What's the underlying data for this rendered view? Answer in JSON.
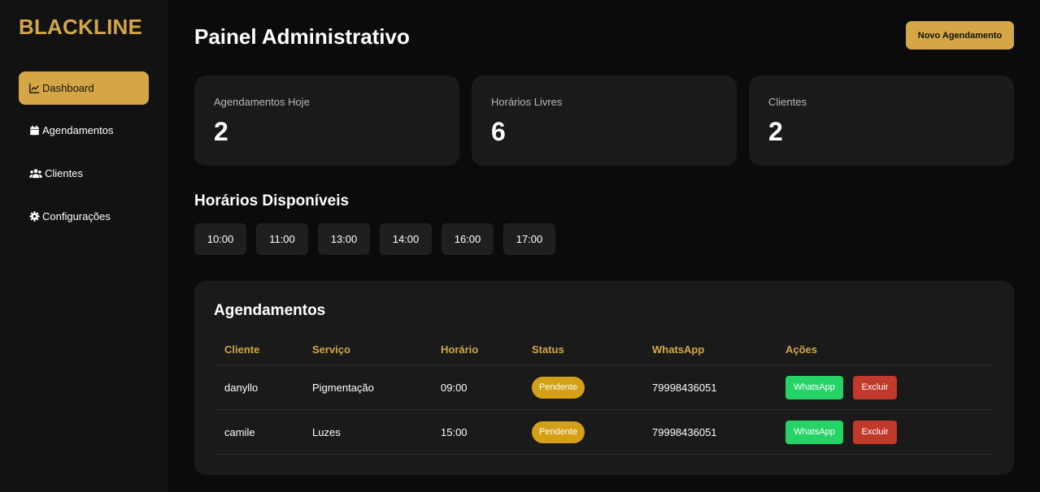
{
  "brand": "BLACKLINE",
  "nav": [
    {
      "label": "Dashboard",
      "icon": "chart-line-icon",
      "active": true
    },
    {
      "label": "Agendamentos",
      "icon": "calendar-icon",
      "active": false
    },
    {
      "label": "Clientes",
      "icon": "users-icon",
      "active": false
    },
    {
      "label": "Configurações",
      "icon": "gear-icon",
      "active": false
    }
  ],
  "header": {
    "title": "Painel Administrativo",
    "new_button": "Novo Agendamento"
  },
  "stats": [
    {
      "label": "Agendamentos Hoje",
      "value": "2"
    },
    {
      "label": "Horários Livres",
      "value": "6"
    },
    {
      "label": "Clientes",
      "value": "2"
    }
  ],
  "slots_section": {
    "title": "Horários Disponíveis",
    "slots": [
      "10:00",
      "11:00",
      "13:00",
      "14:00",
      "16:00",
      "17:00"
    ]
  },
  "appointments": {
    "title": "Agendamentos",
    "columns": [
      "Cliente",
      "Serviço",
      "Horário",
      "Status",
      "WhatsApp",
      "Ações"
    ],
    "rows": [
      {
        "cliente": "danyllo",
        "servico": "Pigmentação",
        "horario": "09:00",
        "status": "Pendente",
        "whatsapp": "79998436051",
        "wa_label": "WhatsApp",
        "del_label": "Excluir"
      },
      {
        "cliente": "camile",
        "servico": "Luzes",
        "horario": "15:00",
        "status": "Pendente",
        "whatsapp": "79998436051",
        "wa_label": "WhatsApp",
        "del_label": "Excluir"
      }
    ]
  },
  "colors": {
    "accent": "#d4a645",
    "status_pending": "#d4a017",
    "whatsapp": "#25d366",
    "danger": "#c0392b"
  }
}
